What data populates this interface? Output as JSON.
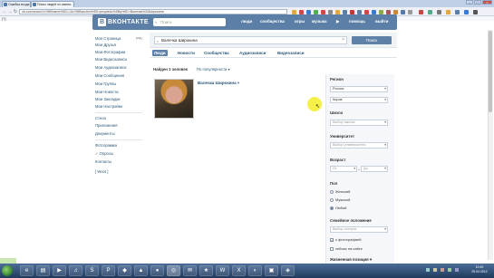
{
  "browser": {
    "tabs": [
      {
        "label": "Ошибка входа"
      },
      {
        "label": "Поиск людей по имени..."
      }
    ],
    "url": "vk.com/search?c%5Bname%5D=1&c%5Bsection%5D=people&c%5Bq%5D=Валечка%20Широкина",
    "bookmark_count": "[?]"
  },
  "vk": {
    "logo_text": "ВКОНТАКТЕ",
    "logo_letter": "В",
    "search_placeholder": "Поиск",
    "nav": {
      "people": "люди",
      "communities": "сообщества",
      "games": "игры",
      "music": "музыка",
      "help": "помощь",
      "logout": "выйти"
    }
  },
  "left_menu": {
    "items": [
      {
        "label": "Моя Страница",
        "count": "ред."
      },
      {
        "label": "Мои Друзья"
      },
      {
        "label": "Мои Фотографии"
      },
      {
        "label": "Мои Видеозаписи"
      },
      {
        "label": "Мои Аудиозаписи"
      },
      {
        "label": "Мои Сообщения"
      },
      {
        "label": "Мои Группы"
      },
      {
        "label": "Мои Новости"
      },
      {
        "label": "Мои Закладки"
      },
      {
        "label": "Мои Настройки"
      }
    ],
    "apps": [
      {
        "label": "Стена"
      },
      {
        "label": "Приложения"
      },
      {
        "label": "Документы"
      }
    ],
    "extras": [
      {
        "label": "Фотограмма"
      },
      {
        "label": "✓ Опросы"
      },
      {
        "label": "Контакты"
      }
    ],
    "bottom_link": "[ Woot ]"
  },
  "search": {
    "query": "Валечка Широкина",
    "button": "Поиск",
    "tabs": [
      "Люди",
      "Новости",
      "Сообщества",
      "Аудиозаписи",
      "Видеозаписи"
    ],
    "found": "Найден 1 человек",
    "sort": "По популярности"
  },
  "result": {
    "name": "Валечка Широкина"
  },
  "filters": {
    "region_heading": "Регион",
    "country": "Россия",
    "city": "Киров",
    "school_heading": "Школа",
    "school_placeholder": "Выбор школы",
    "university_heading": "Университет",
    "university_placeholder": "Выбор университета",
    "age_heading": "Возраст",
    "age_from": "От",
    "age_to": "До",
    "sex_heading": "Пол",
    "sex_options": [
      "Женский",
      "Мужской",
      "Любой"
    ],
    "marital_heading": "Семейное положение",
    "marital_placeholder": "Выбор статуса",
    "with_photo": "с фотографией",
    "online_now": "сейчас на сайте",
    "life_position": "Жизненная позиция"
  },
  "taskbar": {
    "time": "10:49",
    "date": "25.04.2012"
  },
  "colors": {
    "vk_blue": "#5b7fa6",
    "link": "#2b587a",
    "cursor_highlight": "#f3ee33"
  }
}
